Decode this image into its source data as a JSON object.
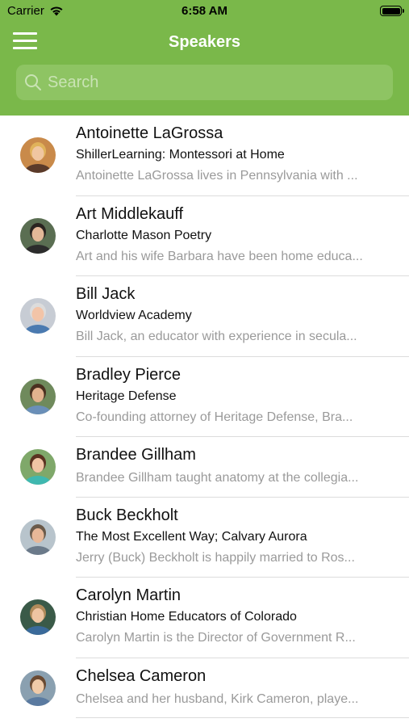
{
  "status_bar": {
    "carrier": "Carrier",
    "time": "6:58 AM"
  },
  "nav": {
    "title": "Speakers"
  },
  "search": {
    "placeholder": "Search"
  },
  "speakers": [
    {
      "name": "Antoinette LaGrossa",
      "org": "ShillerLearning: Montessori at Home",
      "bio": "Antoinette LaGrossa lives in Pennsylvania with ...",
      "avatar": {
        "bg": "#c98a4a",
        "hair": "#e0b25a",
        "skin": "#f0c6a0",
        "shirt": "#5a3a2a"
      }
    },
    {
      "name": "Art Middlekauff",
      "org": "Charlotte Mason Poetry",
      "bio": "Art and his wife Barbara have been home educa...",
      "avatar": {
        "bg": "#5a6e52",
        "hair": "#2a2420",
        "skin": "#e3b898",
        "shirt": "#2c2c2c"
      }
    },
    {
      "name": "Bill Jack",
      "org": "Worldview Academy",
      "bio": "Bill Jack, an educator with experience in secula...",
      "avatar": {
        "bg": "#c7ccd4",
        "hair": "#dcdcdc",
        "skin": "#f2c4a8",
        "shirt": "#4a7ab0"
      }
    },
    {
      "name": "Bradley Pierce",
      "org": "Heritage Defense",
      "bio": "Co-founding attorney of Heritage Defense, Bra...",
      "avatar": {
        "bg": "#6f8a5c",
        "hair": "#4a3020",
        "skin": "#e2b28e",
        "shirt": "#6a8fb8"
      }
    },
    {
      "name": "Brandee Gillham",
      "org": "",
      "bio": "Brandee Gillham taught anatomy at the collegia...",
      "avatar": {
        "bg": "#7fa86a",
        "hair": "#5a3220",
        "skin": "#f0c4a4",
        "shirt": "#3fb8b0"
      }
    },
    {
      "name": "Buck Beckholt",
      "org": "The Most Excellent Way; Calvary Aurora",
      "bio": "Jerry (Buck) Beckholt is happily married to Ros...",
      "avatar": {
        "bg": "#b8c4cc",
        "hair": "#6a5a4a",
        "skin": "#e8b898",
        "shirt": "#6b7a8a"
      }
    },
    {
      "name": "Carolyn Martin",
      "org": "Christian Home Educators of Colorado",
      "bio": "Carolyn Martin is the Director of Government R...",
      "avatar": {
        "bg": "#3a5a48",
        "hair": "#b08a5a",
        "skin": "#eec4a2",
        "shirt": "#3a6a9a"
      }
    },
    {
      "name": "Chelsea Cameron",
      "org": "",
      "bio": "Chelsea and her husband, Kirk Cameron, playe...",
      "avatar": {
        "bg": "#8aa0b0",
        "hair": "#6a4a32",
        "skin": "#f0caa8",
        "shirt": "#5a7aa0"
      }
    }
  ]
}
